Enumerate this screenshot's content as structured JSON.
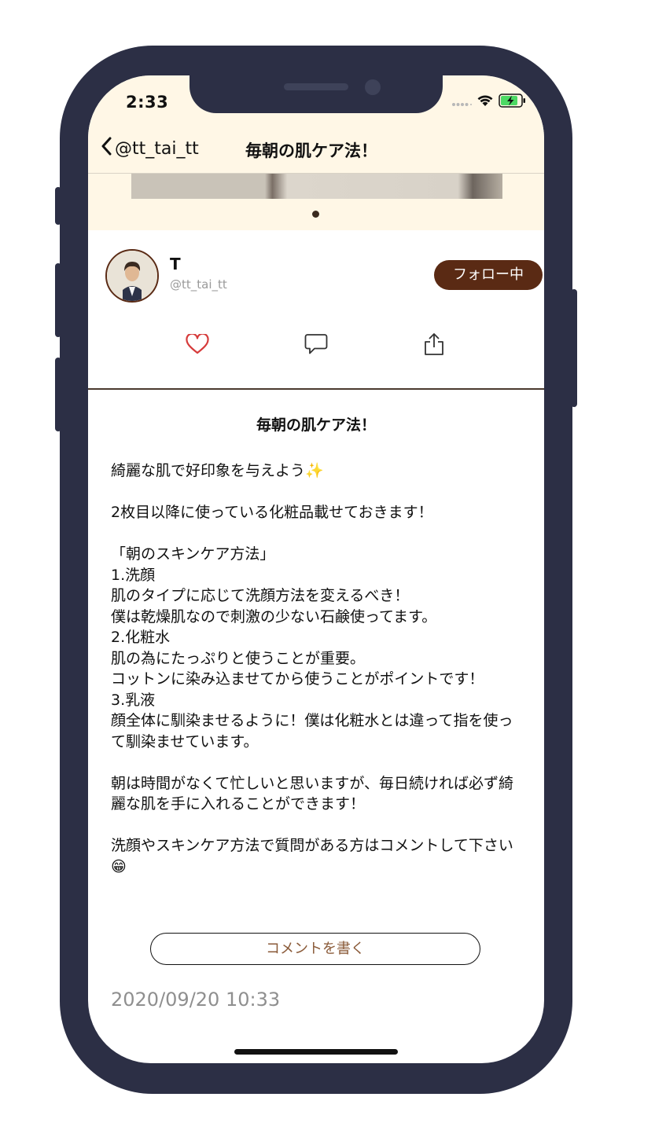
{
  "status_bar": {
    "time": "2:33",
    "signal_icon": "signal-dots-icon",
    "wifi_icon": "wifi-icon",
    "battery_icon": "battery-charging-icon"
  },
  "nav": {
    "back_label": "@tt_tai_tt",
    "title": "毎朝の肌ケア法！"
  },
  "author": {
    "name": "T",
    "handle": "@tt_tai_tt",
    "follow_label": "フォロー中"
  },
  "actions": {
    "like_icon": "heart-icon",
    "comment_icon": "comment-bubble-icon",
    "share_icon": "share-icon",
    "like_color": "#d63b3b"
  },
  "post": {
    "title": "毎朝の肌ケア法！",
    "body": "綺麗な肌で好印象を与えよう✨\n\n2枚目以降に使っている化粧品載せておきます！\n\n「朝のスキンケア方法」\n1.洗顔\n肌のタイプに応じて洗顔方法を変えるべき！\n僕は乾燥肌なので刺激の少ない石鹸使ってます。\n2.化粧水\n肌の為にたっぷりと使うことが重要。\nコットンに染み込ませてから使うことがポイントです！\n3.乳液\n顔全体に馴染ませるように！僕は化粧水とは違って指を使って馴染ませています。\n\n朝は時間がなくて忙しいと思いますが、毎日続ければ必ず綺麗な肌を手に入れることができます！\n\n洗顔やスキンケア方法で質問がある方はコメントして下さい😁",
    "comment_button": "コメントを書く",
    "date": "2020/09/20 10:33"
  },
  "colors": {
    "header_bg": "#fff7e6",
    "accent_brown": "#5a2a14",
    "phone_frame": "#2c2f45"
  }
}
